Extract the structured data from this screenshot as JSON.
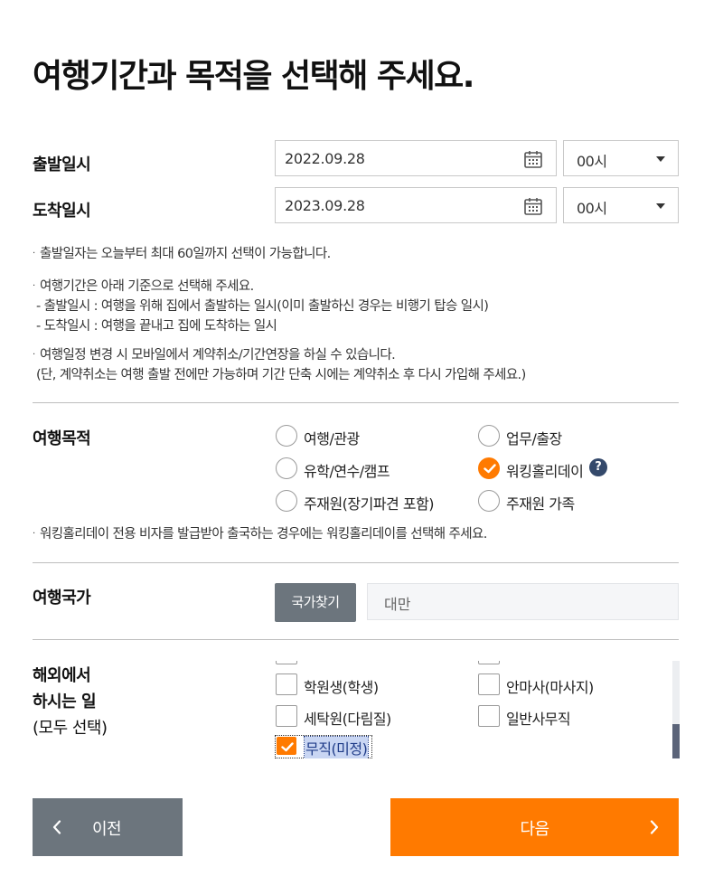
{
  "page_title": "여행기간과 목적을 선택해 주세요.",
  "departure": {
    "label": "출발일시",
    "date": "2022.09.28",
    "hour": "00시"
  },
  "arrival": {
    "label": "도착일시",
    "date": "2023.09.28",
    "hour": "00시"
  },
  "notes": {
    "n1": "출발일자는 오늘부터 최대 60일까지 선택이 가능합니다.",
    "n2": "여행기간은 아래 기준으로 선택해 주세요.",
    "n2a": "- 출발일시 : 여행을 위해 집에서 출발하는 일시(이미 출발하신 경우는 비행기 탑승 일시)",
    "n2b": "- 도착일시 : 여행을 끝내고 집에 도착하는 일시",
    "n3": "여행일정 변경 시 모바일에서 계약취소/기간연장을 하실 수 있습니다.",
    "n3a": "(단, 계약취소는 여행 출발 전에만 가능하며 기간 단축 시에는 계약취소 후 다시 가입해 주세요.)"
  },
  "purpose": {
    "label": "여행목적",
    "options": [
      {
        "label": "여행/관광",
        "selected": false
      },
      {
        "label": "업무/출장",
        "selected": false
      },
      {
        "label": "유학/연수/캠프",
        "selected": false
      },
      {
        "label": "워킹홀리데이",
        "selected": true
      },
      {
        "label": "주재원(장기파견 포함)",
        "selected": false
      },
      {
        "label": "주재원 가족",
        "selected": false
      }
    ],
    "help_icon": "question-icon",
    "help_glyph": "?",
    "note": "워킹홀리데이 전용 비자를 발급받아 출국하는 경우에는 워킹홀리데이를 선택해 주세요."
  },
  "country": {
    "label": "여행국가",
    "search_button": "국가찾기",
    "value": "대만"
  },
  "jobs": {
    "label_line1": "해외에서",
    "label_line2": "하시는 일",
    "label_line3": "(모두 선택)",
    "options": [
      {
        "label": "학원생(학생)",
        "checked": false
      },
      {
        "label": "안마사(마사지)",
        "checked": false
      },
      {
        "label": "세탁원(다림질)",
        "checked": false
      },
      {
        "label": "일반사무직",
        "checked": false
      },
      {
        "label": "무직(미정)",
        "checked": true
      }
    ]
  },
  "buttons": {
    "prev": "이전",
    "next": "다음"
  },
  "colors": {
    "accent": "#ff7a00",
    "gray_button": "#6c757d",
    "help_icon": "#34496b"
  }
}
